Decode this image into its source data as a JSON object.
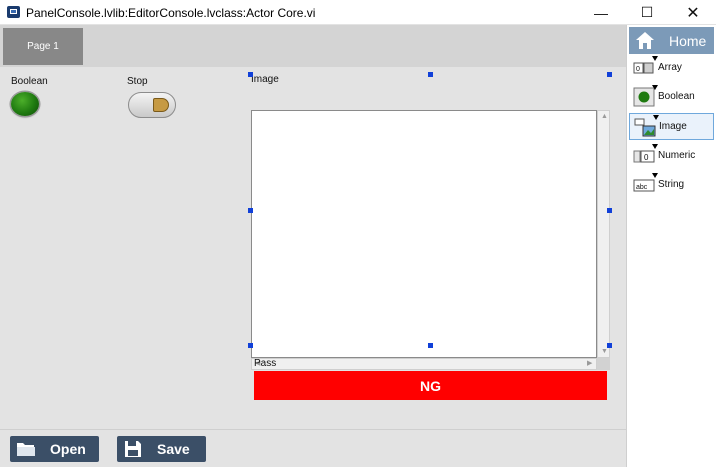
{
  "window": {
    "title": "PanelConsole.lvlib:EditorConsole.lvclass:Actor Core.vi",
    "minimize_glyph": "—",
    "maximize_glyph": "☐",
    "close_glyph": "✕"
  },
  "tabs": [
    {
      "label": "Page 1"
    }
  ],
  "controls": {
    "boolean_label": "Boolean",
    "stop_label": "Stop",
    "image_label": "Image",
    "pass_label": "Pass",
    "pass_value": "NG"
  },
  "actions": {
    "open_label": "Open",
    "save_label": "Save"
  },
  "palette": {
    "home_label": "Home",
    "items": [
      {
        "label": "Array",
        "icon": "array-icon"
      },
      {
        "label": "Boolean",
        "icon": "boolean-icon"
      },
      {
        "label": "Image",
        "icon": "image-icon"
      },
      {
        "label": "Numeric",
        "icon": "numeric-icon"
      },
      {
        "label": "String",
        "icon": "string-icon"
      }
    ],
    "numeric_icon_text": "0",
    "string_icon_text": "abc"
  },
  "colors": {
    "ng_background": "#ff0000",
    "action_button": "#3b4f67",
    "home_button": "#7c9ab8",
    "led_on": "#1f7a10"
  }
}
